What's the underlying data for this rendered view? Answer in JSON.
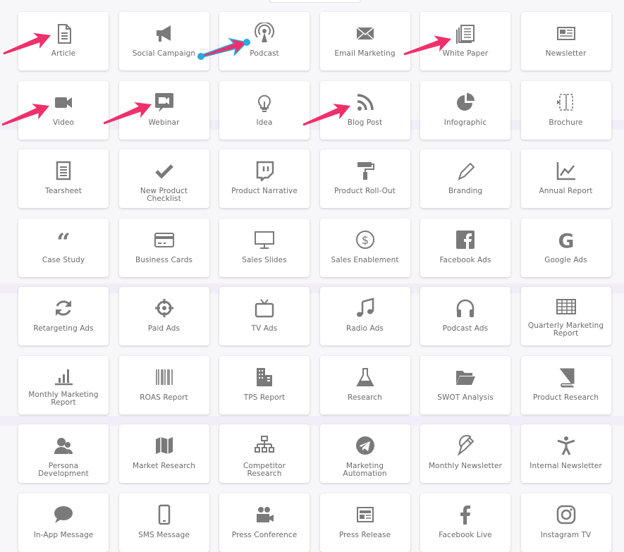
{
  "accent_arrow_color": "#f0306a",
  "accent_dot_color": "#2aa9df",
  "icon_color": "#7a7a7a",
  "items": [
    {
      "label": "Article",
      "icon": "document-icon"
    },
    {
      "label": "Social Campaign",
      "icon": "megaphone-icon"
    },
    {
      "label": "Podcast",
      "icon": "podcast-icon"
    },
    {
      "label": "Email Marketing",
      "icon": "envelope-icon"
    },
    {
      "label": "White Paper",
      "icon": "newspaper-stack-icon"
    },
    {
      "label": "Newsletter",
      "icon": "newspaper-icon"
    },
    {
      "label": "Video",
      "icon": "video-camera-icon"
    },
    {
      "label": "Webinar",
      "icon": "webinar-icon"
    },
    {
      "label": "Idea",
      "icon": "lightbulb-icon"
    },
    {
      "label": "Blog Post",
      "icon": "rss-icon"
    },
    {
      "label": "Infographic",
      "icon": "pie-chart-icon"
    },
    {
      "label": "Brochure",
      "icon": "brochure-icon"
    },
    {
      "label": "Tearsheet",
      "icon": "list-document-icon"
    },
    {
      "label": "New Product Checklist",
      "icon": "checkmark-icon"
    },
    {
      "label": "Product Narrative",
      "icon": "twitch-icon"
    },
    {
      "label": "Product Roll-Out",
      "icon": "paint-roller-icon"
    },
    {
      "label": "Branding",
      "icon": "pen-icon"
    },
    {
      "label": "Annual Report",
      "icon": "line-chart-icon"
    },
    {
      "label": "Case Study",
      "icon": "quote-icon"
    },
    {
      "label": "Business Cards",
      "icon": "credit-card-icon"
    },
    {
      "label": "Sales Slides",
      "icon": "monitor-icon"
    },
    {
      "label": "Sales Enablement",
      "icon": "dollar-circle-icon"
    },
    {
      "label": "Facebook Ads",
      "icon": "facebook-square-icon"
    },
    {
      "label": "Google Ads",
      "icon": "google-icon"
    },
    {
      "label": "Retargeting Ads",
      "icon": "refresh-icon"
    },
    {
      "label": "Paid Ads",
      "icon": "crosshairs-icon"
    },
    {
      "label": "TV Ads",
      "icon": "tv-icon"
    },
    {
      "label": "Radio Ads",
      "icon": "music-note-icon"
    },
    {
      "label": "Podcast Ads",
      "icon": "headphones-icon"
    },
    {
      "label": "Quarterly Marketing Report",
      "icon": "table-icon"
    },
    {
      "label": "Monthly Marketing Report",
      "icon": "bar-chart-icon"
    },
    {
      "label": "ROAS Report",
      "icon": "barcode-icon"
    },
    {
      "label": "TPS Report",
      "icon": "building-icon"
    },
    {
      "label": "Research",
      "icon": "flask-icon"
    },
    {
      "label": "SWOT Analysis",
      "icon": "folder-open-icon"
    },
    {
      "label": "Product Research",
      "icon": "book-icon"
    },
    {
      "label": "Persona Development",
      "icon": "users-icon"
    },
    {
      "label": "Market Research",
      "icon": "map-icon"
    },
    {
      "label": "Competitor Research",
      "icon": "sitemap-icon"
    },
    {
      "label": "Marketing Automation",
      "icon": "telegram-icon"
    },
    {
      "label": "Monthly Newsletter",
      "icon": "fountain-pen-icon"
    },
    {
      "label": "Internal Newsletter",
      "icon": "person-icon"
    },
    {
      "label": "In-App Message",
      "icon": "speech-bubble-icon"
    },
    {
      "label": "SMS Message",
      "icon": "mobile-phone-icon"
    },
    {
      "label": "Press Conference",
      "icon": "video-conference-icon"
    },
    {
      "label": "Press Release",
      "icon": "press-release-icon"
    },
    {
      "label": "Facebook Live",
      "icon": "facebook-f-icon"
    },
    {
      "label": "Instagram TV",
      "icon": "instagram-icon"
    }
  ]
}
